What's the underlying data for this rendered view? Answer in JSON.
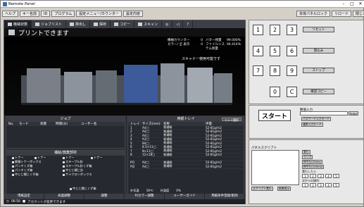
{
  "window": {
    "title": "Remote Panel"
  },
  "menu": [
    "ヘルプ",
    "キー名前",
    "ID",
    "プログラム",
    "設定メニュー/カウンター",
    "設定内容"
  ],
  "right_top": [
    "本体パネルロック",
    "リロード",
    "閉じる"
  ],
  "tabs": [
    {
      "label": "機械状態",
      "icon": "home-icon"
    },
    {
      "label": "ジョブリスト",
      "icon": "list-icon"
    },
    {
      "label": "排出し",
      "icon": "output-icon"
    },
    {
      "label": "保存",
      "icon": "folder-icon"
    },
    {
      "label": "コピー",
      "icon": "copy-icon"
    },
    {
      "label": "スキャン",
      "icon": "scan-icon"
    }
  ],
  "tab_icons": [
    "globe-icon",
    "speaker-icon",
    "help-icon"
  ],
  "status_msg": "プリントできます",
  "machine_status": {
    "row1": [
      "機械カウンター",
      "0",
      "バター残量",
      "99.000%"
    ],
    "row2": [
      "カラー/ 全 表示",
      "0",
      "ファイルシステム残量",
      "94.414%"
    ],
    "scanner": "スキャナー使用可能です"
  },
  "jobs": {
    "title": "ジョブ",
    "columns": [
      "No.",
      "モード",
      "状態",
      "時間(分)",
      "ユーザー名"
    ]
  },
  "consumables": {
    "title": "補給/廃棄部材",
    "items": [
      [
        "トナー",
        "トナー",
        "トナー",
        "トナー"
      ],
      [
        "廃棄トナーボックス",
        "ステープル針"
      ],
      [
        "パンチくず箱",
        "ステープル針くず箱"
      ],
      [
        "パンチくず箱",
        "中とじ綴じ針"
      ],
      [
        "中とじ綴じくず箱",
        "サイクロンボックス"
      ],
      [
        "中とじ綴じくず箱"
      ]
    ]
  },
  "trays": {
    "title": "用紙トレイ",
    "paper_tray_btn": "トレイ選択",
    "columns": [
      "トレイ",
      "サイズ(mm)",
      "名称",
      "坪量"
    ],
    "rows": [
      [
        "1",
        "A4□",
        "普通紙",
        "52-81g/m2"
      ],
      [
        "2",
        "A4□",
        "普通紙",
        "52-81g/m2"
      ],
      [
        "3",
        "A4□",
        "普通紙",
        "52-81g/m2"
      ],
      [
        "4",
        "A3□",
        "普通紙",
        "52-81g/m2"
      ],
      [
        "5",
        "B4□",
        "普通紙",
        "52-81g/m2"
      ],
      [
        "6",
        "8.5×11□",
        "普通紙",
        "52-81g/m2"
      ],
      [
        "7",
        "8×11□",
        "普通紙",
        "52-81g/m2"
      ],
      [
        "8",
        "12×18□",
        "普通紙",
        "52-81g/m2"
      ],
      [
        "",
        "",
        "",
        ""
      ],
      [
        "PI1",
        "A4□",
        "普通紙",
        "52-81g/m2"
      ],
      [
        "PI2",
        "A4□",
        "普通紙",
        "52-81g/m2"
      ]
    ],
    "footer": [
      "外気温",
      "18℃",
      "外湿度",
      "0%"
    ]
  },
  "bottom_tabs": [
    "用紙設定",
    "表面調整",
    "調整",
    "RIカラー調整",
    "ユーザーガイド",
    "用紙条件登録/削除"
  ],
  "statusline": {
    "time": "06:56",
    "msg": "アカウントが変更できます"
  },
  "keypad": {
    "keys": [
      "1",
      "2",
      "3",
      "4",
      "5",
      "6",
      "7",
      "8",
      "9",
      "0",
      "C"
    ],
    "reset": "リセット",
    "interrupt": "割込み",
    "stop": "ストップ",
    "confirm": "確認コピー"
  },
  "start": {
    "label": "スタート",
    "numeric_label": "数値入力",
    "enter": "Enter",
    "password": "パスワード入力モード",
    "user": "通常入力モード"
  },
  "script": {
    "title": "パネルスクリプト",
    "btns": [
      "実行",
      "クリア",
      "待ち行(10ms)",
      "待ち行(100ms)",
      "実行したら"
    ],
    "record": "スクリプト実行",
    "save": "結果表示",
    "nums": [
      "1",
      "2",
      "3",
      "4",
      "5"
    ],
    "lines": "次からの操作:"
  }
}
